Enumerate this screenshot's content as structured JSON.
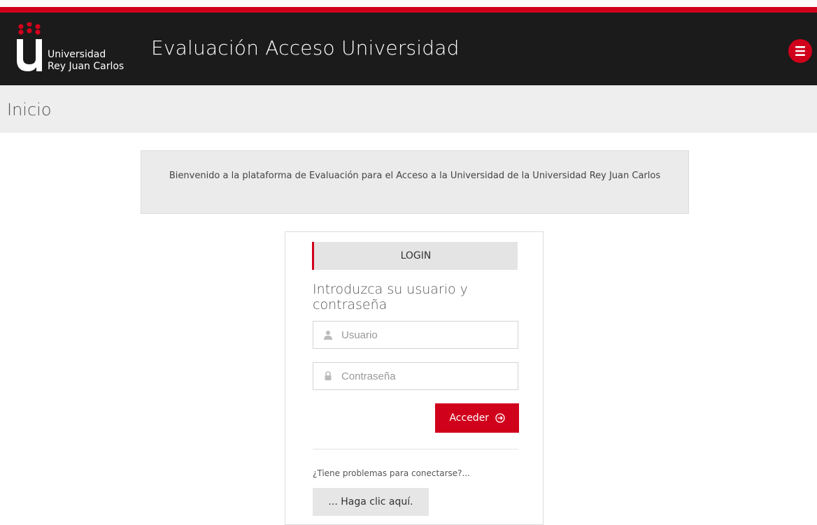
{
  "brand": {
    "line1": "Universidad",
    "line2": "Rey Juan Carlos",
    "logo_icon": "urjc-u-logo",
    "accent_color": "#d0021b",
    "header_bg": "#1b1b1b"
  },
  "header": {
    "title": "Evaluación Acceso Universidad",
    "menu_icon": "hamburger-menu-icon"
  },
  "page": {
    "title": "Inicio"
  },
  "welcome": {
    "text": "Bienvenido a la plataforma de Evaluación para el Acceso a la Universidad de la Universidad Rey Juan Carlos"
  },
  "login": {
    "tab_label": "LOGIN",
    "heading": "Introduzca su usuario y contraseña",
    "username": {
      "placeholder": "Usuario",
      "value": "",
      "icon": "user-icon"
    },
    "password": {
      "placeholder": "Contraseña",
      "value": "",
      "icon": "lock-icon"
    },
    "submit_label": "Acceder",
    "submit_icon": "circle-arrow-right-icon",
    "help_prompt": "¿Tiene problemas para conectarse?...",
    "help_button_label": "... Haga clic aquí."
  }
}
